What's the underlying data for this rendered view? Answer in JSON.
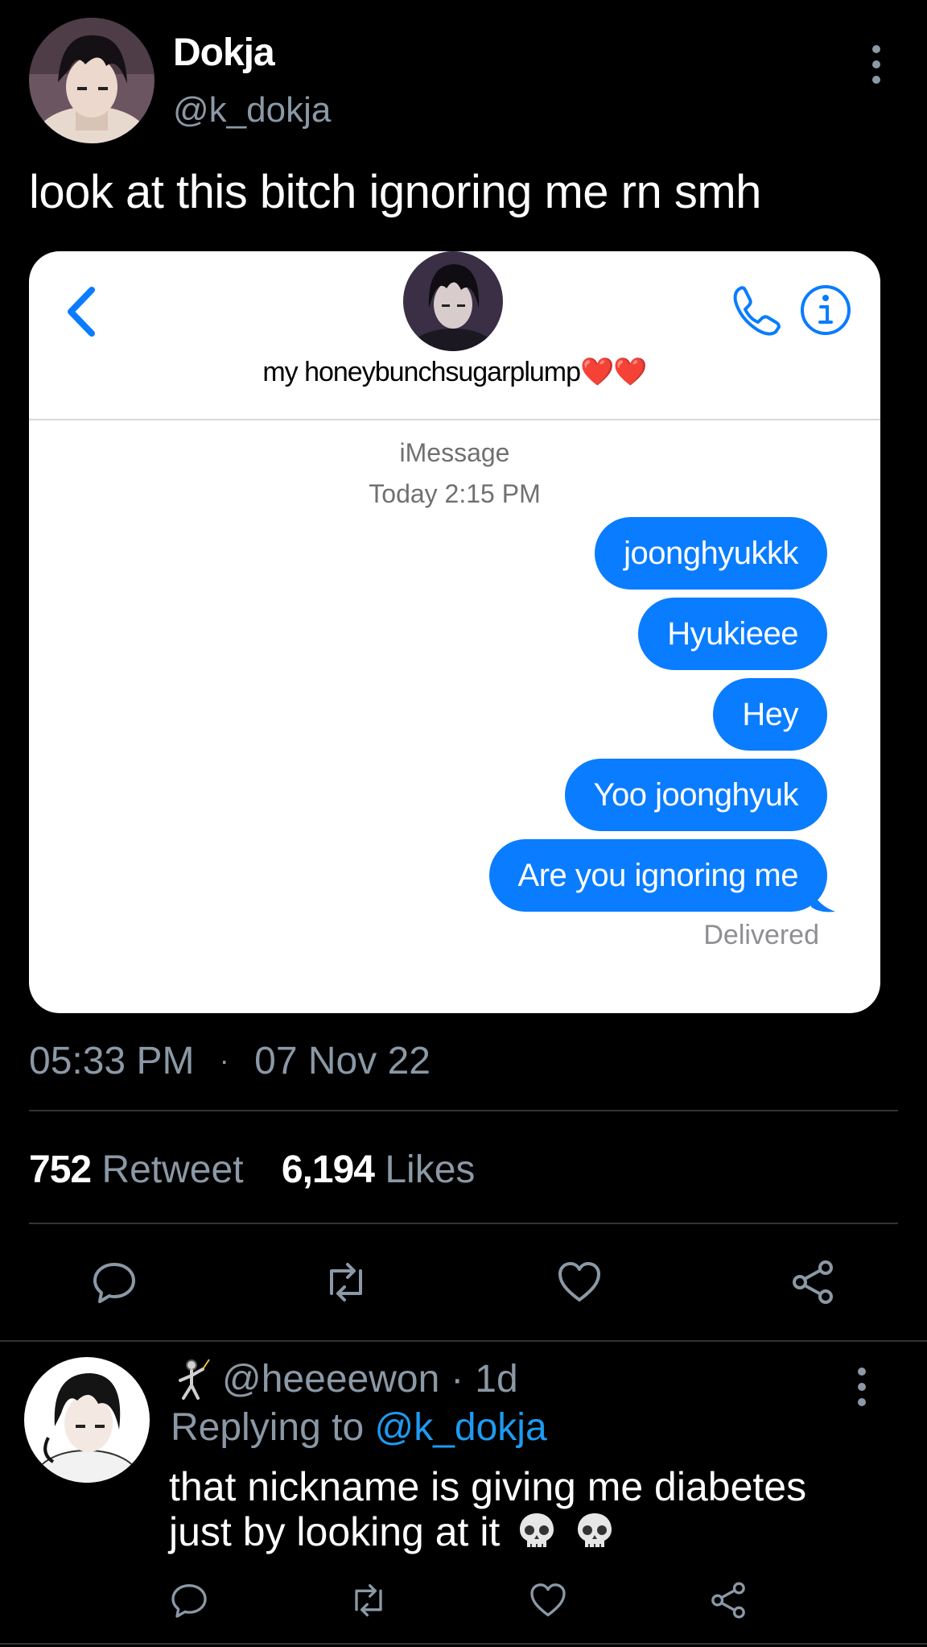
{
  "tweet": {
    "author_name": "Dokja",
    "author_handle": "@k_dokja",
    "text": "look at this bitch ignoring me rn smh",
    "time": "05:33 PM",
    "separator": "·",
    "date": "07 Nov 22",
    "retweet_count": "752",
    "retweet_label": "Retweet",
    "like_count": "6,194",
    "like_label": "Likes"
  },
  "imessage": {
    "contact_name": "my honeybunchsugarplump❤️❤️",
    "service": "iMessage",
    "timestamp": "Today 2:15 PM",
    "messages": [
      "joonghyukkk",
      "Hyukieee",
      "Hey",
      "Yoo joonghyuk",
      "Are you ignoring me"
    ],
    "status": "Delivered"
  },
  "reply": {
    "handle": "@heeeewon",
    "separator": "·",
    "age": "1d",
    "replying_prefix": "Replying to",
    "replying_to": "@k_dokja",
    "text_line1": "that nickname is giving me diabetes",
    "text_line2": "just by looking at it"
  },
  "icons": {
    "reply": "reply-icon",
    "retweet": "retweet-icon",
    "like": "heart-icon",
    "share": "share-icon",
    "more": "more-options-icon"
  },
  "colors": {
    "background": "#000000",
    "muted": "#8b98a5",
    "link": "#1d9bf0",
    "imessage_blue": "#0a7cff"
  }
}
